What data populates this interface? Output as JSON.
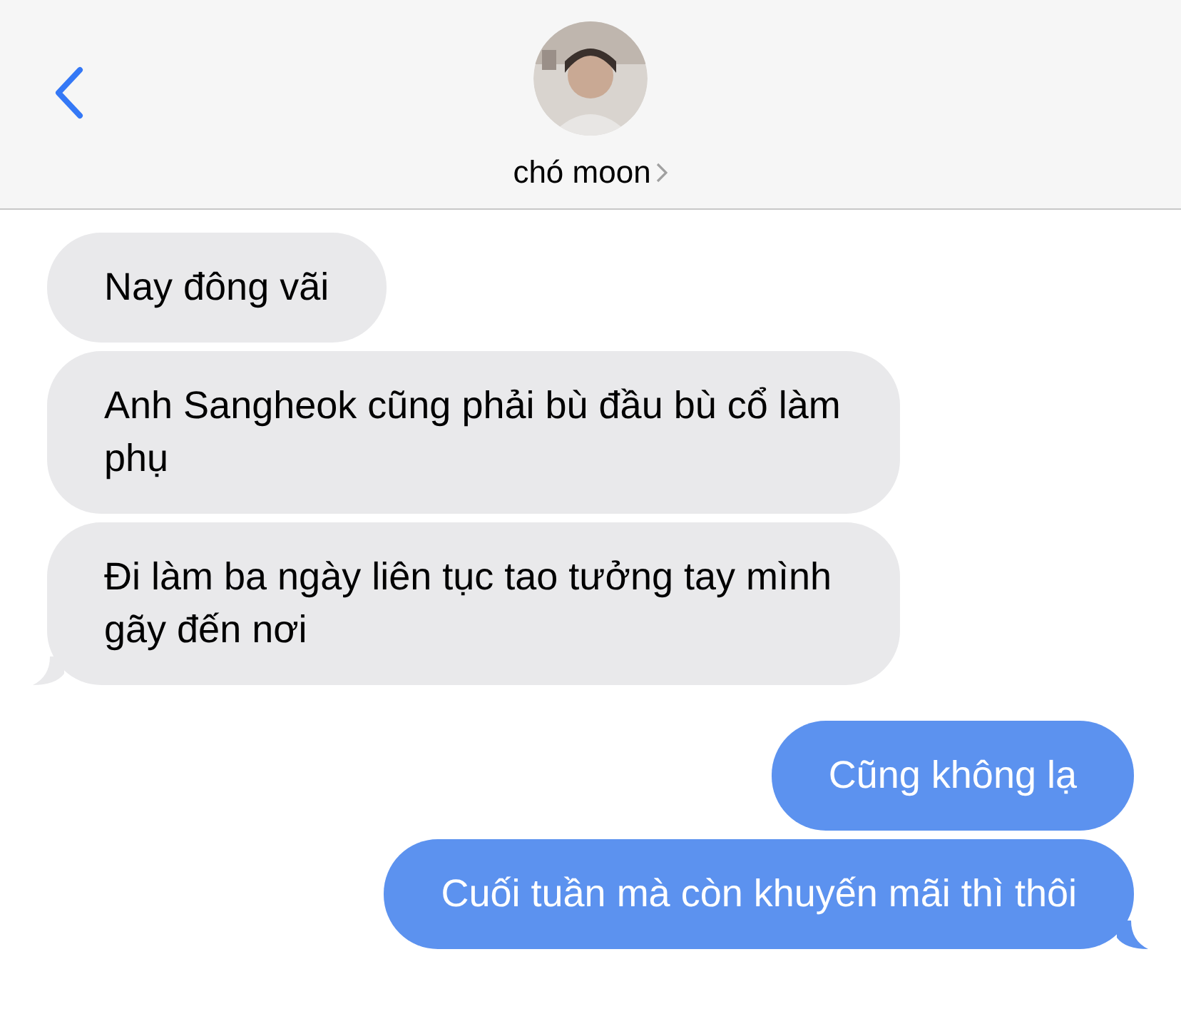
{
  "header": {
    "contact_name": "chó moon"
  },
  "messages": [
    {
      "kind": "received",
      "text": "Nay đông vãi",
      "tail": false
    },
    {
      "kind": "received",
      "text": "Anh Sangheok cũng phải bù đầu bù cổ làm phụ",
      "tail": false
    },
    {
      "kind": "received",
      "text": "Đi làm ba ngày liên tục tao tưởng tay mình gãy đến nơi",
      "tail": true
    },
    {
      "kind": "sent",
      "text": "Cũng không lạ",
      "tail": false
    },
    {
      "kind": "sent",
      "text": "Cuối tuần mà còn khuyến mãi thì thôi",
      "tail": true
    }
  ]
}
